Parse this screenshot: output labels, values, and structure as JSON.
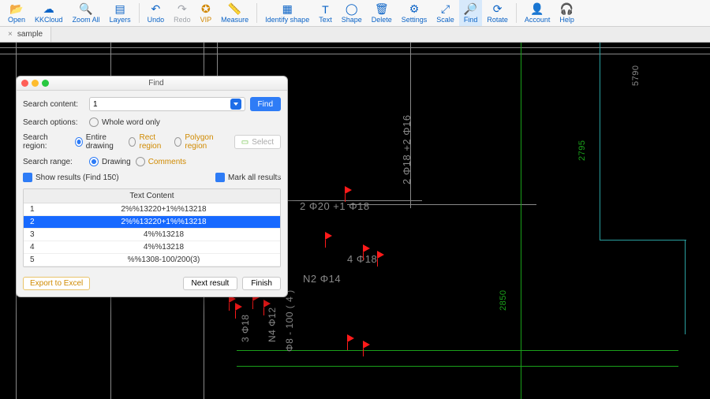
{
  "toolbar": {
    "open": "Open",
    "kkcloud": "KKCloud",
    "zoomall": "Zoom All",
    "layers": "Layers",
    "undo": "Undo",
    "redo": "Redo",
    "vip": "VIP",
    "measure": "Measure",
    "identify": "Identify shape",
    "text": "Text",
    "shape": "Shape",
    "delete": "Delete",
    "settings": "Settings",
    "scale": "Scale",
    "find": "Find",
    "rotate": "Rotate",
    "account": "Account",
    "help": "Help"
  },
  "tab": {
    "name": "sample"
  },
  "dialog": {
    "title": "Find",
    "searchContentLabel": "Search content:",
    "searchContentValue": "1",
    "findBtn": "Find",
    "searchOptionsLabel": "Search options:",
    "wholeWord": "Whole word only",
    "searchRegionLabel": "Search region:",
    "region": {
      "entire": "Entire drawing",
      "rect": "Rect region",
      "polygon": "Polygon region"
    },
    "selectBtn": "Select",
    "searchRangeLabel": "Search range:",
    "range": {
      "drawing": "Drawing",
      "comments": "Comments"
    },
    "showResults": "Show results (Find 150)",
    "markAll": "Mark all results",
    "tableHeader": "Text Content",
    "rows": [
      {
        "idx": "1",
        "val": "2%%13220+1%%13218"
      },
      {
        "idx": "2",
        "val": "2%%13220+1%%13218"
      },
      {
        "idx": "3",
        "val": "4%%13218"
      },
      {
        "idx": "4",
        "val": "4%%13218"
      },
      {
        "idx": "5",
        "val": "%%1308-100/200(3)"
      }
    ],
    "export": "Export to Excel",
    "next": "Next result",
    "finish": "Finish"
  },
  "cad": {
    "t5790": "5790",
    "t2795": "2795",
    "t2850": "2850",
    "t2f18_2f16": "2 Φ18 +2 Φ16",
    "t2f20_f18": "2 Φ20 +1 Φ18",
    "t4f18": "4 Φ18",
    "tN2f14": "N2 Φ14",
    "t3f18v": "3 Φ18",
    "tN4f12v": "N4 Φ12",
    "tf8v": "Φ8 - 100 ( 4 )"
  },
  "chart_data": {
    "type": "table",
    "title": "Text Content",
    "rows": [
      [
        1,
        "2%%13220+1%%13218"
      ],
      [
        2,
        "2%%13220+1%%13218"
      ],
      [
        3,
        "4%%13218"
      ],
      [
        4,
        "4%%13218"
      ],
      [
        5,
        "%%1308-100/200(3)"
      ]
    ]
  }
}
